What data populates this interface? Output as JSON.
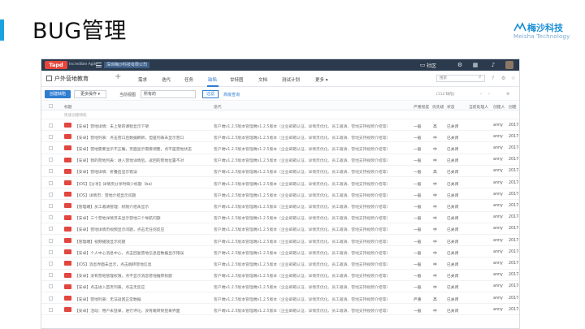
{
  "slide": {
    "title": "BUG管理",
    "accent_color": "#1aa3e0"
  },
  "logo": {
    "name": "梅沙科技",
    "sub": "Meisha Technology",
    "icon": "mountain-logo-icon"
  },
  "app": {
    "brand": "Tapd",
    "brand_sub": "Incredible Agile",
    "company": "深圳梅沙科技有限公司",
    "community": "社区",
    "project_name": "户外营地教育",
    "nav_tabs": [
      "需求",
      "迭代",
      "任务",
      "缺陷",
      "甘特图",
      "文档",
      "测试计划",
      "更多 ▾"
    ],
    "active_tab_index": 3,
    "search_placeholder": "搜索",
    "toolbar": {
      "create_button": "创建缺陷",
      "more_button": "更多操作 ▾",
      "filter_label": "当前视图",
      "filter_value": "所有的",
      "filter_button": "过滤",
      "advanced_link": "高级查询",
      "count": "(112 缺陷)",
      "pager_prev": "‹",
      "pager_next": "›"
    },
    "table": {
      "headers": {
        "title": "标题",
        "iteration": "迭代",
        "severity": "严重程度",
        "priority": "优先级",
        "status": "状态",
        "handler": "当前处理人",
        "creator": "创建人",
        "created": "创建"
      },
      "quick_create": "快速创建缺陷",
      "rows": [
        {
          "title": "【安卓】营地详情：未上架的课程显示下架",
          "iteration": "客户端v1.2.5版本管理端v1.2.5版本（企业邮箱认证、详情页优化、员工邀请、营地支持视频介绍等）",
          "severity": "一般",
          "priority": "高",
          "status": "已关闭",
          "creator": "anny",
          "date": "2017-4"
        },
        {
          "title": "【安卓】营地列表：点击营口后数据刷新，但是列表未显示营口",
          "iteration": "客户端v1.2.5版本管理端v1.2.5版本（企业邮箱认证、详情页优化、员工邀请、营地支持视频介绍等）",
          "severity": "一般",
          "priority": "中",
          "status": "已关闭",
          "creator": "anny",
          "date": "2017-4"
        },
        {
          "title": "【安卓】营地需要显示不正确，页面显示需要调整，点不是营地状态",
          "iteration": "客户端v1.2.5版本管理端v1.2.5版本（企业邮箱认证、详情页优化、员工邀请、营地支持视频介绍等）",
          "severity": "一般",
          "priority": "中",
          "status": "已关闭",
          "creator": "anny",
          "date": "2017-4"
        },
        {
          "title": "【安卓】我的营地列表：进入营地详情后，返回的营地位置不对",
          "iteration": "客户端v1.2.5版本管理端v1.2.5版本（企业邮箱认证、详情页优化、员工邀请、营地支持视频介绍等）",
          "severity": "一般",
          "priority": "中",
          "status": "已关闭",
          "creator": "anny",
          "date": "2017-4"
        },
        {
          "title": "【安卓】营地详情：折叠后显示错误",
          "iteration": "客户端v1.2.5版本管理端v1.2.5版本（企业邮箱认证、详情页优化、员工邀请、营地支持视频介绍等）",
          "severity": "一般",
          "priority": "高",
          "status": "已关闭",
          "creator": "anny",
          "date": "2017-4"
        },
        {
          "title": "【iOS】【分享】详情页分享时缺少标题（ba）",
          "iteration": "客户端v1.2.5版本管理端v1.2.5版本（企业邮箱认证、详情页优化、员工邀请、营地支持视频介绍等）",
          "severity": "一般",
          "priority": "中",
          "status": "已关闭",
          "creator": "anny",
          "date": "2017-4"
        },
        {
          "title": "【iOS】详情页：营地介绍显示问题",
          "iteration": "客户端v1.2.5版本管理端v1.2.5版本（企业邮箱认证、详情页优化、员工邀请、营地支持视频介绍等）",
          "severity": "一般",
          "priority": "中",
          "status": "已关闭",
          "creator": "anny",
          "date": "2017-4"
        },
        {
          "title": "【管理端】员工邀请管理：权限介绍未显示",
          "iteration": "客户端v1.2.5版本管理端v1.2.5版本（企业邮箱认证、详情页优化、员工邀请、营地支持视频介绍等）",
          "severity": "一般",
          "priority": "中",
          "status": "已关闭",
          "creator": "anny",
          "date": "2017-4"
        },
        {
          "title": "【安卓】三个营地详情页未显示营地三个导航问题",
          "iteration": "客户端v1.2.5版本管理端v1.2.5版本（企业邮箱认证、详情页优化、员工邀请、营地支持视频介绍等）",
          "severity": "一般",
          "priority": "中",
          "status": "已关闭",
          "creator": "anny",
          "date": "2017-4"
        },
        {
          "title": "【安卓】营地详情页视频显示问题，点击无任何反应",
          "iteration": "客户端v1.2.5版本管理端v1.2.5版本（企业邮箱认证、详情页优化、员工邀请、营地支持视频介绍等）",
          "severity": "一般",
          "priority": "中",
          "status": "已关闭",
          "creator": "anny",
          "date": "2017-4"
        },
        {
          "title": "【管理端】视频播放显示问题",
          "iteration": "客户端v1.2.5版本管理端v1.2.5版本（企业邮箱认证、详情页优化、员工邀请、营地支持视频介绍等）",
          "severity": "一般",
          "priority": "中",
          "status": "已关闭",
          "creator": "anny",
          "date": "2017-4"
        },
        {
          "title": "【安卓】个人中心消息中心，点击回复营地信息后数据显示错误",
          "iteration": "客户端v1.2.5版本管理端v1.2.5版本（企业邮箱认证、详情页优化、员工邀请、营地支持视频介绍等）",
          "severity": "一般",
          "priority": "中",
          "status": "已关闭",
          "creator": "anny",
          "date": "2017-4"
        },
        {
          "title": "【iOS】消息界面未显示，点击跳转营地信息",
          "iteration": "客户端v1.2.5版本管理端v1.2.5版本（企业邮箱认证、详情页优化、员工邀请、营地支持视频介绍等）",
          "severity": "一般",
          "priority": "中",
          "status": "已关闭",
          "creator": "anny",
          "date": "2017-4"
        },
        {
          "title": "【安卓】没有营地管理权限，点不显示消息营地推荐标题",
          "iteration": "客户端v1.2.5版本管理端v1.2.5版本（企业邮箱认证、详情页优化、员工邀请、营地支持视频介绍等）",
          "severity": "一般",
          "priority": "中",
          "status": "已关闭",
          "creator": "anny",
          "date": "2017-4"
        },
        {
          "title": "【安卓】点击进入首页列表，点击无反应",
          "iteration": "客户端v1.2.5版本管理端v1.2.5版本（企业邮箱认证、详情页优化、员工邀请、营地支持视频介绍等）",
          "severity": "一般",
          "priority": "中",
          "status": "已关闭",
          "creator": "anny",
          "date": "2017-4"
        },
        {
          "title": "【安卓】营地列表：无法返回正常数据",
          "iteration": "客户端v1.2.5版本管理端v1.2.5版本（企业邮箱认证、详情页优化、员工邀请、营地支持视频介绍等）",
          "severity": "严重",
          "priority": "高",
          "status": "已关闭",
          "creator": "anny",
          "date": "2017-4"
        },
        {
          "title": "【安卓】活动：用户未登录，进行评论，没有跳转到登录界面",
          "iteration": "客户端v1.2.5版本管理端v1.2.5版本（企业邮箱认证、详情页优化、员工邀请、营地支持视频介绍等）",
          "severity": "一般",
          "priority": "中",
          "status": "已关闭",
          "creator": "anny",
          "date": "2017-4"
        }
      ]
    }
  }
}
